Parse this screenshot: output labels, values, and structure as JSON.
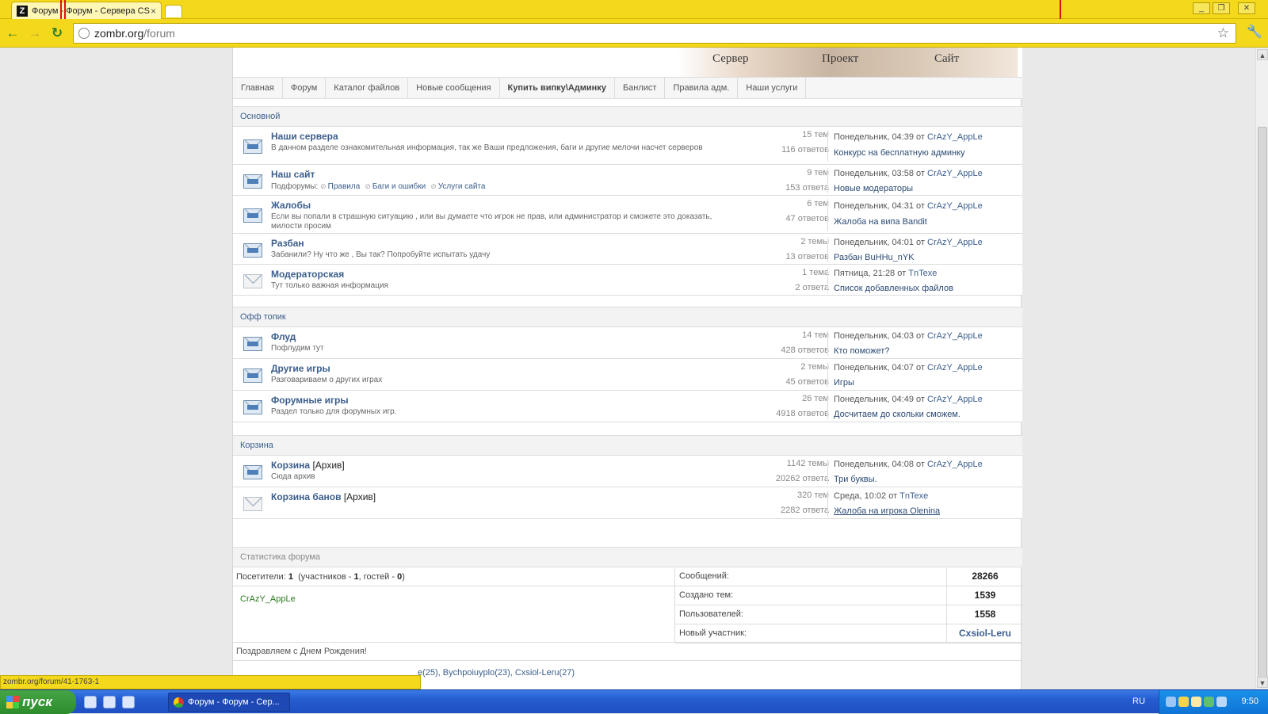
{
  "browser": {
    "tab_title": "Форум - Форум - Сервера CS",
    "tab_close": "×",
    "favicon_letter": "Z",
    "url_host": "zombr.org",
    "url_path": "/forum",
    "status_url": "zombr.org/forum/41-1763-1"
  },
  "banner": {
    "item1": "Сервер",
    "item2": "Проект",
    "item3": "Сайт"
  },
  "menu": [
    "Главная",
    "Форум",
    "Каталог файлов",
    "Новые сообщения",
    "Купить випку\\Админку",
    "Банлист",
    "Правила адм.",
    "Наши услуги"
  ],
  "categories": {
    "main": "Основной",
    "offtopic": "Офф топик",
    "trash": "Корзина"
  },
  "forums": [
    {
      "title": "Наши сервера",
      "desc": "В данном разделе ознакомительная информация, так же Ваши предложения, баги и другие мелочи насчет серверов",
      "topics": "15 тем",
      "posts": "116 ответов",
      "last_time": "Понедельник, 04:39",
      "from": "от",
      "last_user": "CrAzY_AppLe",
      "last_topic": "Конкурс на бесплатную админку",
      "unread": true
    },
    {
      "title": "Наш сайт",
      "subforums_label": "Подфорумы:",
      "subforums": [
        "Правила",
        "Баги и ошибки",
        "Услуги сайта"
      ],
      "topics": "9 тем",
      "posts": "153 ответа",
      "last_time": "Понедельник, 03:58",
      "from": "от",
      "last_user": "CrAzY_AppLe",
      "last_topic": "Новые модераторы",
      "unread": true
    },
    {
      "title": "Жалобы",
      "desc": "Если вы попали в страшную ситуацию , или вы думаете что игрок не прав, или администратор и сможете это доказать, милости просим",
      "topics": "6 тем",
      "posts": "47 ответов",
      "last_time": "Понедельник, 04:31",
      "from": "от",
      "last_user": "CrAzY_AppLe",
      "last_topic": "Жалоба на випа Bandit",
      "unread": true
    },
    {
      "title": "Разбан",
      "desc": "Забанили? Ну что же , Вы так? Попробуйте испытать удачу",
      "topics": "2 темы",
      "posts": "13 ответов",
      "last_time": "Понедельник, 04:01",
      "from": "от",
      "last_user": "CrAzY_AppLe",
      "last_topic": "Разбан BuHHu_nYK",
      "unread": true
    },
    {
      "title": "Модераторская",
      "desc": "Тут только важная информация",
      "topics": "1 тема",
      "posts": "2 ответа",
      "last_time": "Пятница, 21:28",
      "from": "от",
      "last_user": "TnTexe",
      "last_topic": "Список добавленных файлов",
      "unread": false
    },
    {
      "title": "Флуд",
      "desc": "Пофлудим тут",
      "topics": "14 тем",
      "posts": "428 ответов",
      "last_time": "Понедельник, 04:03",
      "from": "от",
      "last_user": "CrAzY_AppLe",
      "last_topic": "Кто поможет?",
      "unread": true
    },
    {
      "title": "Другие игры",
      "desc": "Разговариваем о других играх",
      "topics": "2 темы",
      "posts": "45 ответов",
      "last_time": "Понедельник, 04:07",
      "from": "от",
      "last_user": "CrAzY_AppLe",
      "last_topic": "Игры",
      "unread": true
    },
    {
      "title": "Форумные игры",
      "desc": "Раздел только для форумных игр.",
      "topics": "26 тем",
      "posts": "4918 ответов",
      "last_time": "Понедельник, 04:49",
      "from": "от",
      "last_user": "CrAzY_AppLe",
      "last_topic": "Досчитаем до скольки сможем.",
      "unread": true
    },
    {
      "title": "Корзина",
      "archive": "[Архив]",
      "desc": "Сюда архив",
      "topics": "1142 темы",
      "posts": "20262 ответа",
      "last_time": "Понедельник, 04:08",
      "from": "от",
      "last_user": "CrAzY_AppLe",
      "last_topic": "Три буквы.",
      "unread": true
    },
    {
      "title": "Корзина банов",
      "archive": "[Архив]",
      "desc": "",
      "topics": "320 тем",
      "posts": "2282 ответа",
      "last_time": "Среда, 10:02",
      "from": "от",
      "last_user": "TnTexe",
      "last_topic": "Жалоба на игрока Olenina",
      "unread": false
    }
  ],
  "stats": {
    "title": "Статистика форума",
    "visitors_label": "Посетители:",
    "visitors_count": "1",
    "members_label": "(участников -",
    "members_count": "1",
    "guests_label": ", гостей -",
    "guests_count": "0",
    "close": ")",
    "online_user": "CrAzY_AppLe",
    "messages_label": "Сообщений:",
    "messages": "28266",
    "topics_label": "Создано тем:",
    "topics": "1539",
    "users_label": "Пользователей:",
    "users": "1558",
    "newest_label": "Новый участник:",
    "newest": "Cxsiol-Leru",
    "birthday": "Поздравляем с Днем Рождения!",
    "birthday_list": "e(25), Bychpoiuyplo(23), Cxsiol-Leru(27)"
  },
  "taskbar": {
    "start": "пуск",
    "task": "Форум - Форум - Сер...",
    "lang": "RU",
    "clock": "9:50"
  }
}
